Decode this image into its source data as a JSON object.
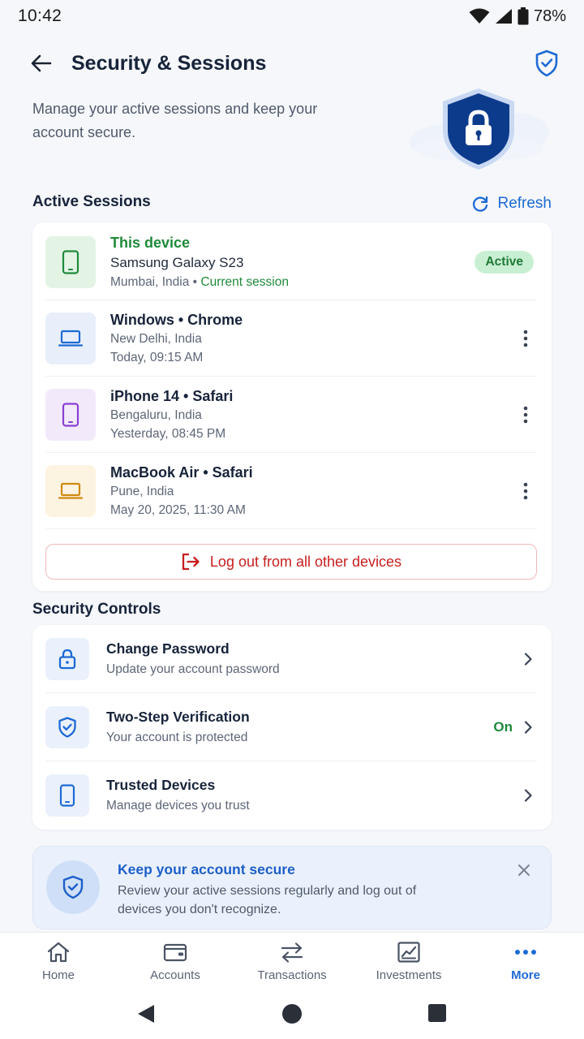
{
  "status_bar": {
    "time": "10:42",
    "battery": "78%"
  },
  "header": {
    "title": "Security & Sessions"
  },
  "intro": {
    "text": "Manage your active sessions and keep your account secure."
  },
  "active_sessions": {
    "title": "Active Sessions",
    "refresh_label": "Refresh",
    "current": {
      "tag": "This device",
      "device": "Samsung Galaxy S23",
      "location": "Mumbai, India",
      "separator": " • ",
      "session_label": "Current session",
      "badge": "Active"
    },
    "others": [
      {
        "device": "Windows • Chrome",
        "location": "New Delhi, India",
        "time": "Today, 09:15 AM"
      },
      {
        "device": "iPhone 14 • Safari",
        "location": "Bengaluru, India",
        "time": "Yesterday, 08:45 PM"
      },
      {
        "device": "MacBook Air • Safari",
        "location": "Pune, India",
        "time": "May 20, 2025, 11:30 AM"
      }
    ],
    "logout_all_label": "Log out from all other devices"
  },
  "security_controls": {
    "title": "Security Controls",
    "items": [
      {
        "title": "Change Password",
        "subtitle": "Update your account password"
      },
      {
        "title": "Two-Step Verification",
        "subtitle": "Your account is protected",
        "status": "On"
      },
      {
        "title": "Trusted Devices",
        "subtitle": "Manage devices you trust"
      }
    ]
  },
  "tip": {
    "title": "Keep your account secure",
    "body": "Review your active sessions regularly and log out of devices you don't recognize."
  },
  "bottom_nav": {
    "items": [
      {
        "label": "Home",
        "icon": "home-icon"
      },
      {
        "label": "Accounts",
        "icon": "wallet-icon"
      },
      {
        "label": "Transactions",
        "icon": "transfer-icon"
      },
      {
        "label": "Investments",
        "icon": "chart-icon"
      },
      {
        "label": "More",
        "icon": "more-dots-icon"
      }
    ],
    "active_index": 4
  },
  "colors": {
    "accent": "#1d6ad6",
    "success": "#1f8a3a",
    "danger": "#c81e1e",
    "shield_dark": "#0d3b8c"
  }
}
